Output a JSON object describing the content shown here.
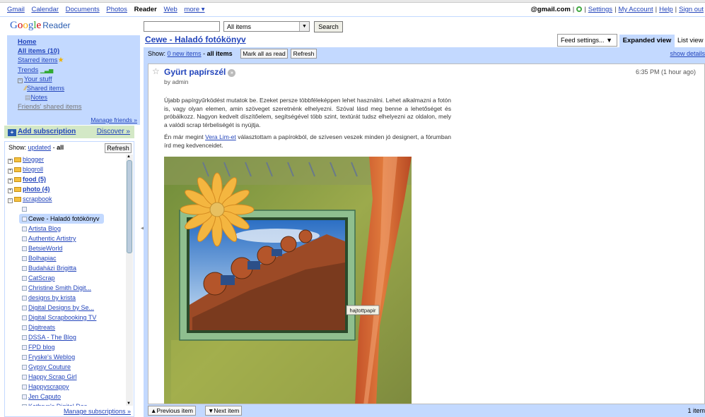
{
  "topnav": {
    "links": [
      "Gmail",
      "Calendar",
      "Documents",
      "Photos"
    ],
    "current": "Reader",
    "more_links": [
      "Web",
      "more ▾"
    ],
    "account": "@gmail.com",
    "right_links": [
      "Settings",
      "My Account",
      "Help",
      "Sign out"
    ]
  },
  "logo": {
    "g": "G",
    "o1": "o",
    "o2": "o",
    "g2": "g",
    "l": "l",
    "e": "e",
    "product": "Reader"
  },
  "search": {
    "value": "",
    "scope": "All items",
    "button": "Search"
  },
  "nav": {
    "home": "Home",
    "all_items": "All items (10)",
    "starred": "Starred items",
    "trends": "Trends",
    "your_stuff": "Your stuff",
    "shared": "Shared items",
    "notes": "Notes",
    "friends_shared": "Friends' shared items",
    "manage_friends": "Manage friends »"
  },
  "add_subscription": {
    "label": "Add subscription",
    "discover": "Discover »"
  },
  "subscriptions": {
    "show_prefix": "Show:",
    "show_updated": "updated",
    "show_all": "all",
    "refresh": "Refresh",
    "folders": [
      {
        "name": "blogger",
        "bold": false
      },
      {
        "name": "blogroll",
        "bold": false
      },
      {
        "name": "food (5)",
        "bold": true
      },
      {
        "name": "photo (4)",
        "bold": true
      },
      {
        "name": "scrapbook",
        "bold": false,
        "open": true
      }
    ],
    "feeds": [
      "",
      "Cewe - Haladó fotókönyv",
      "Artista Blog",
      "Authentic Artistry",
      "BetsieWorld",
      "Bolhapiac",
      "Budaházi Brigitta",
      "CatScrap",
      "Christine Smith Digit...",
      "designs by krista",
      "Digital Designs by Se...",
      "Digital Scrapbooking TV",
      "Digitreats",
      "DSSA - The Blog",
      "FPD blog",
      "Fryske's Weblog",
      "Gypsy Couture",
      "Happy Scrap Girl",
      "Happyscrappy",
      "Jen Caputo",
      "Kathryn's Digital Des..."
    ],
    "manage": "Manage subscriptions »"
  },
  "feed": {
    "title": "Cewe - Haladó fotókönyv",
    "settings": "Feed settings...",
    "expanded_view": "Expanded view",
    "list_view": "List view",
    "show_label": "Show:",
    "new_items": "0 new items",
    "all_items": "all items",
    "mark_all": "Mark all as read",
    "refresh": "Refresh",
    "show_details": "show details"
  },
  "entry": {
    "title": "Gyürt papírszél",
    "author": "by admin",
    "time": "6:35 PM (1 hour ago)",
    "p1": "Újabb papírgyűrködést mutatok be. Ezeket persze többféleképpen lehet használni. Lehet alkalmazni a fotón is, vagy olyan elemen, amin szöveget szeretnénk elhelyezni. Szóval lásd meg benne a lehetőséget és próbálkozz. Nagyon kedvelt díszítőelem, segítségével több szint, textúrát tudsz elhelyezni az oldalon, mely a valódi scrap térbeliségét is nyújtja.",
    "p2_before": "Én már megint ",
    "p2_link": "Vera Lim-et",
    "p2_after": " választottam a papírokból, de szívesen veszek minden jó designert, a fórumban írd meg kedvenceidet.",
    "tooltip": "hajtottpapir"
  },
  "bottom": {
    "prev": "Previous item",
    "next": "Next item",
    "count": "1 item"
  },
  "colors": {
    "accent": "#c3d9ff",
    "link": "#2244bb",
    "add_bg": "#d3e8c6"
  }
}
